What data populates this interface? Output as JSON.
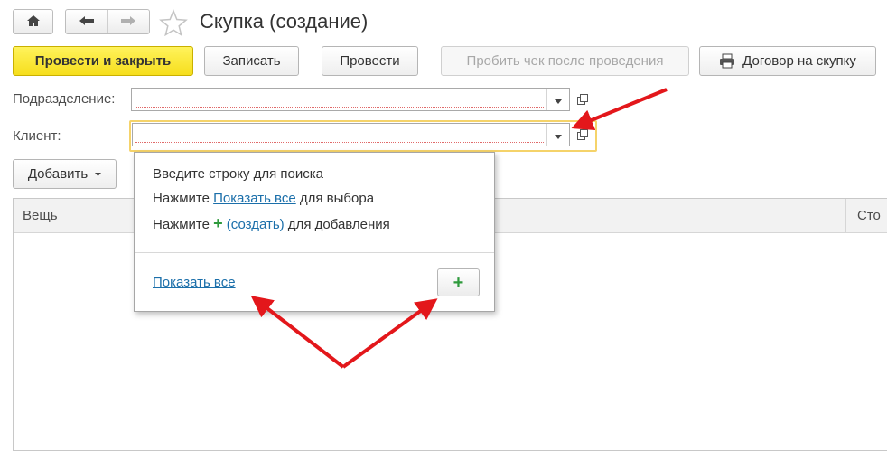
{
  "window": {
    "title": "Скупка (создание)"
  },
  "toolbar": {
    "post_close_label": "Провести и закрыть",
    "save_label": "Записать",
    "post_label": "Провести",
    "print_receipt_label": "Пробить чек после проведения",
    "contract_label": "Договор на скупку"
  },
  "form": {
    "division_label": "Подразделение:",
    "division_value": "",
    "client_label": "Клиент:",
    "client_value": ""
  },
  "table": {
    "add_button_label": "Добавить",
    "columns": [
      "Вещь",
      "Сто"
    ]
  },
  "dropdown": {
    "line1": "Введите строку для поиска",
    "line2_prefix": "Нажмите ",
    "line2_link": "Показать все",
    "line2_suffix": " для выбора",
    "line3_prefix": "Нажмите ",
    "line3_link": " (создать)",
    "line3_suffix": " для добавления",
    "show_all_link": "Показать все"
  },
  "icons": {
    "home": "home-icon",
    "back": "arrow-left-icon",
    "forward": "arrow-right-icon",
    "favorite": "star-icon",
    "printer": "printer-icon",
    "plus": "plus-icon",
    "open": "open-form-icon"
  },
  "colors": {
    "primary_button": "#f6de1c",
    "link": "#1b6faa",
    "plus": "#2e9a3c",
    "annotation_arrow": "#e3171b",
    "focus_frame": "#f5d36a"
  }
}
